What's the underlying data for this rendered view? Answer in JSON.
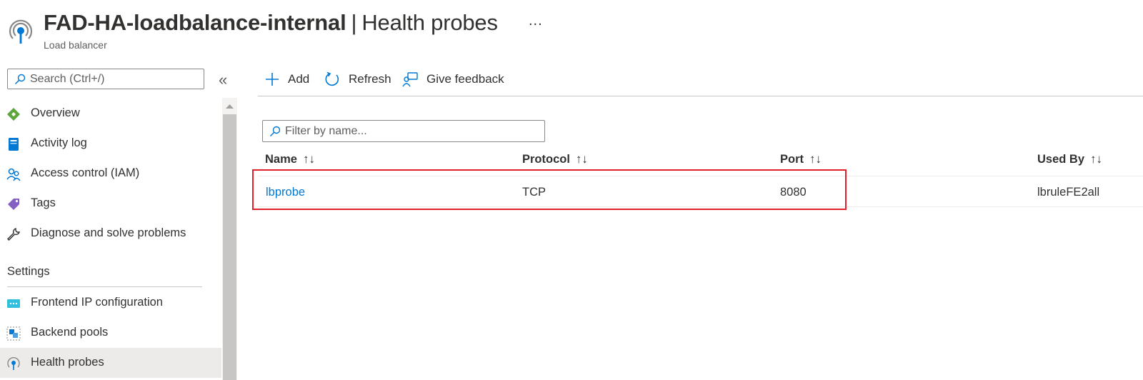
{
  "header": {
    "resource_name": "FAD-HA-loadbalance-internal",
    "separator": "|",
    "page_name": "Health probes",
    "more_label": "...",
    "resource_type": "Load balancer"
  },
  "sidebar": {
    "search_placeholder": "Search (Ctrl+/)",
    "collapse_label": "«",
    "items": [
      {
        "label": "Overview",
        "icon": "overview-icon"
      },
      {
        "label": "Activity log",
        "icon": "activity-log-icon"
      },
      {
        "label": "Access control (IAM)",
        "icon": "iam-icon"
      },
      {
        "label": "Tags",
        "icon": "tag-icon"
      },
      {
        "label": "Diagnose and solve problems",
        "icon": "wrench-icon"
      }
    ],
    "settings_header": "Settings",
    "settings_items": [
      {
        "label": "Frontend IP configuration",
        "icon": "frontend-ip-icon"
      },
      {
        "label": "Backend pools",
        "icon": "backend-pools-icon"
      },
      {
        "label": "Health probes",
        "icon": "health-probe-icon",
        "selected": true
      }
    ]
  },
  "toolbar": {
    "add_label": "Add",
    "refresh_label": "Refresh",
    "feedback_label": "Give feedback"
  },
  "filter": {
    "placeholder": "Filter by name..."
  },
  "table": {
    "sort_glyph": "↑↓",
    "columns": [
      "Name",
      "Protocol",
      "Port",
      "Used By"
    ],
    "rows": [
      {
        "name": "lbprobe",
        "protocol": "TCP",
        "port": "8080",
        "used_by": "lbruleFE2all"
      }
    ]
  },
  "colors": {
    "accent": "#0078d4",
    "highlight_border": "#e0202a",
    "selected_bg": "#edebe9"
  }
}
